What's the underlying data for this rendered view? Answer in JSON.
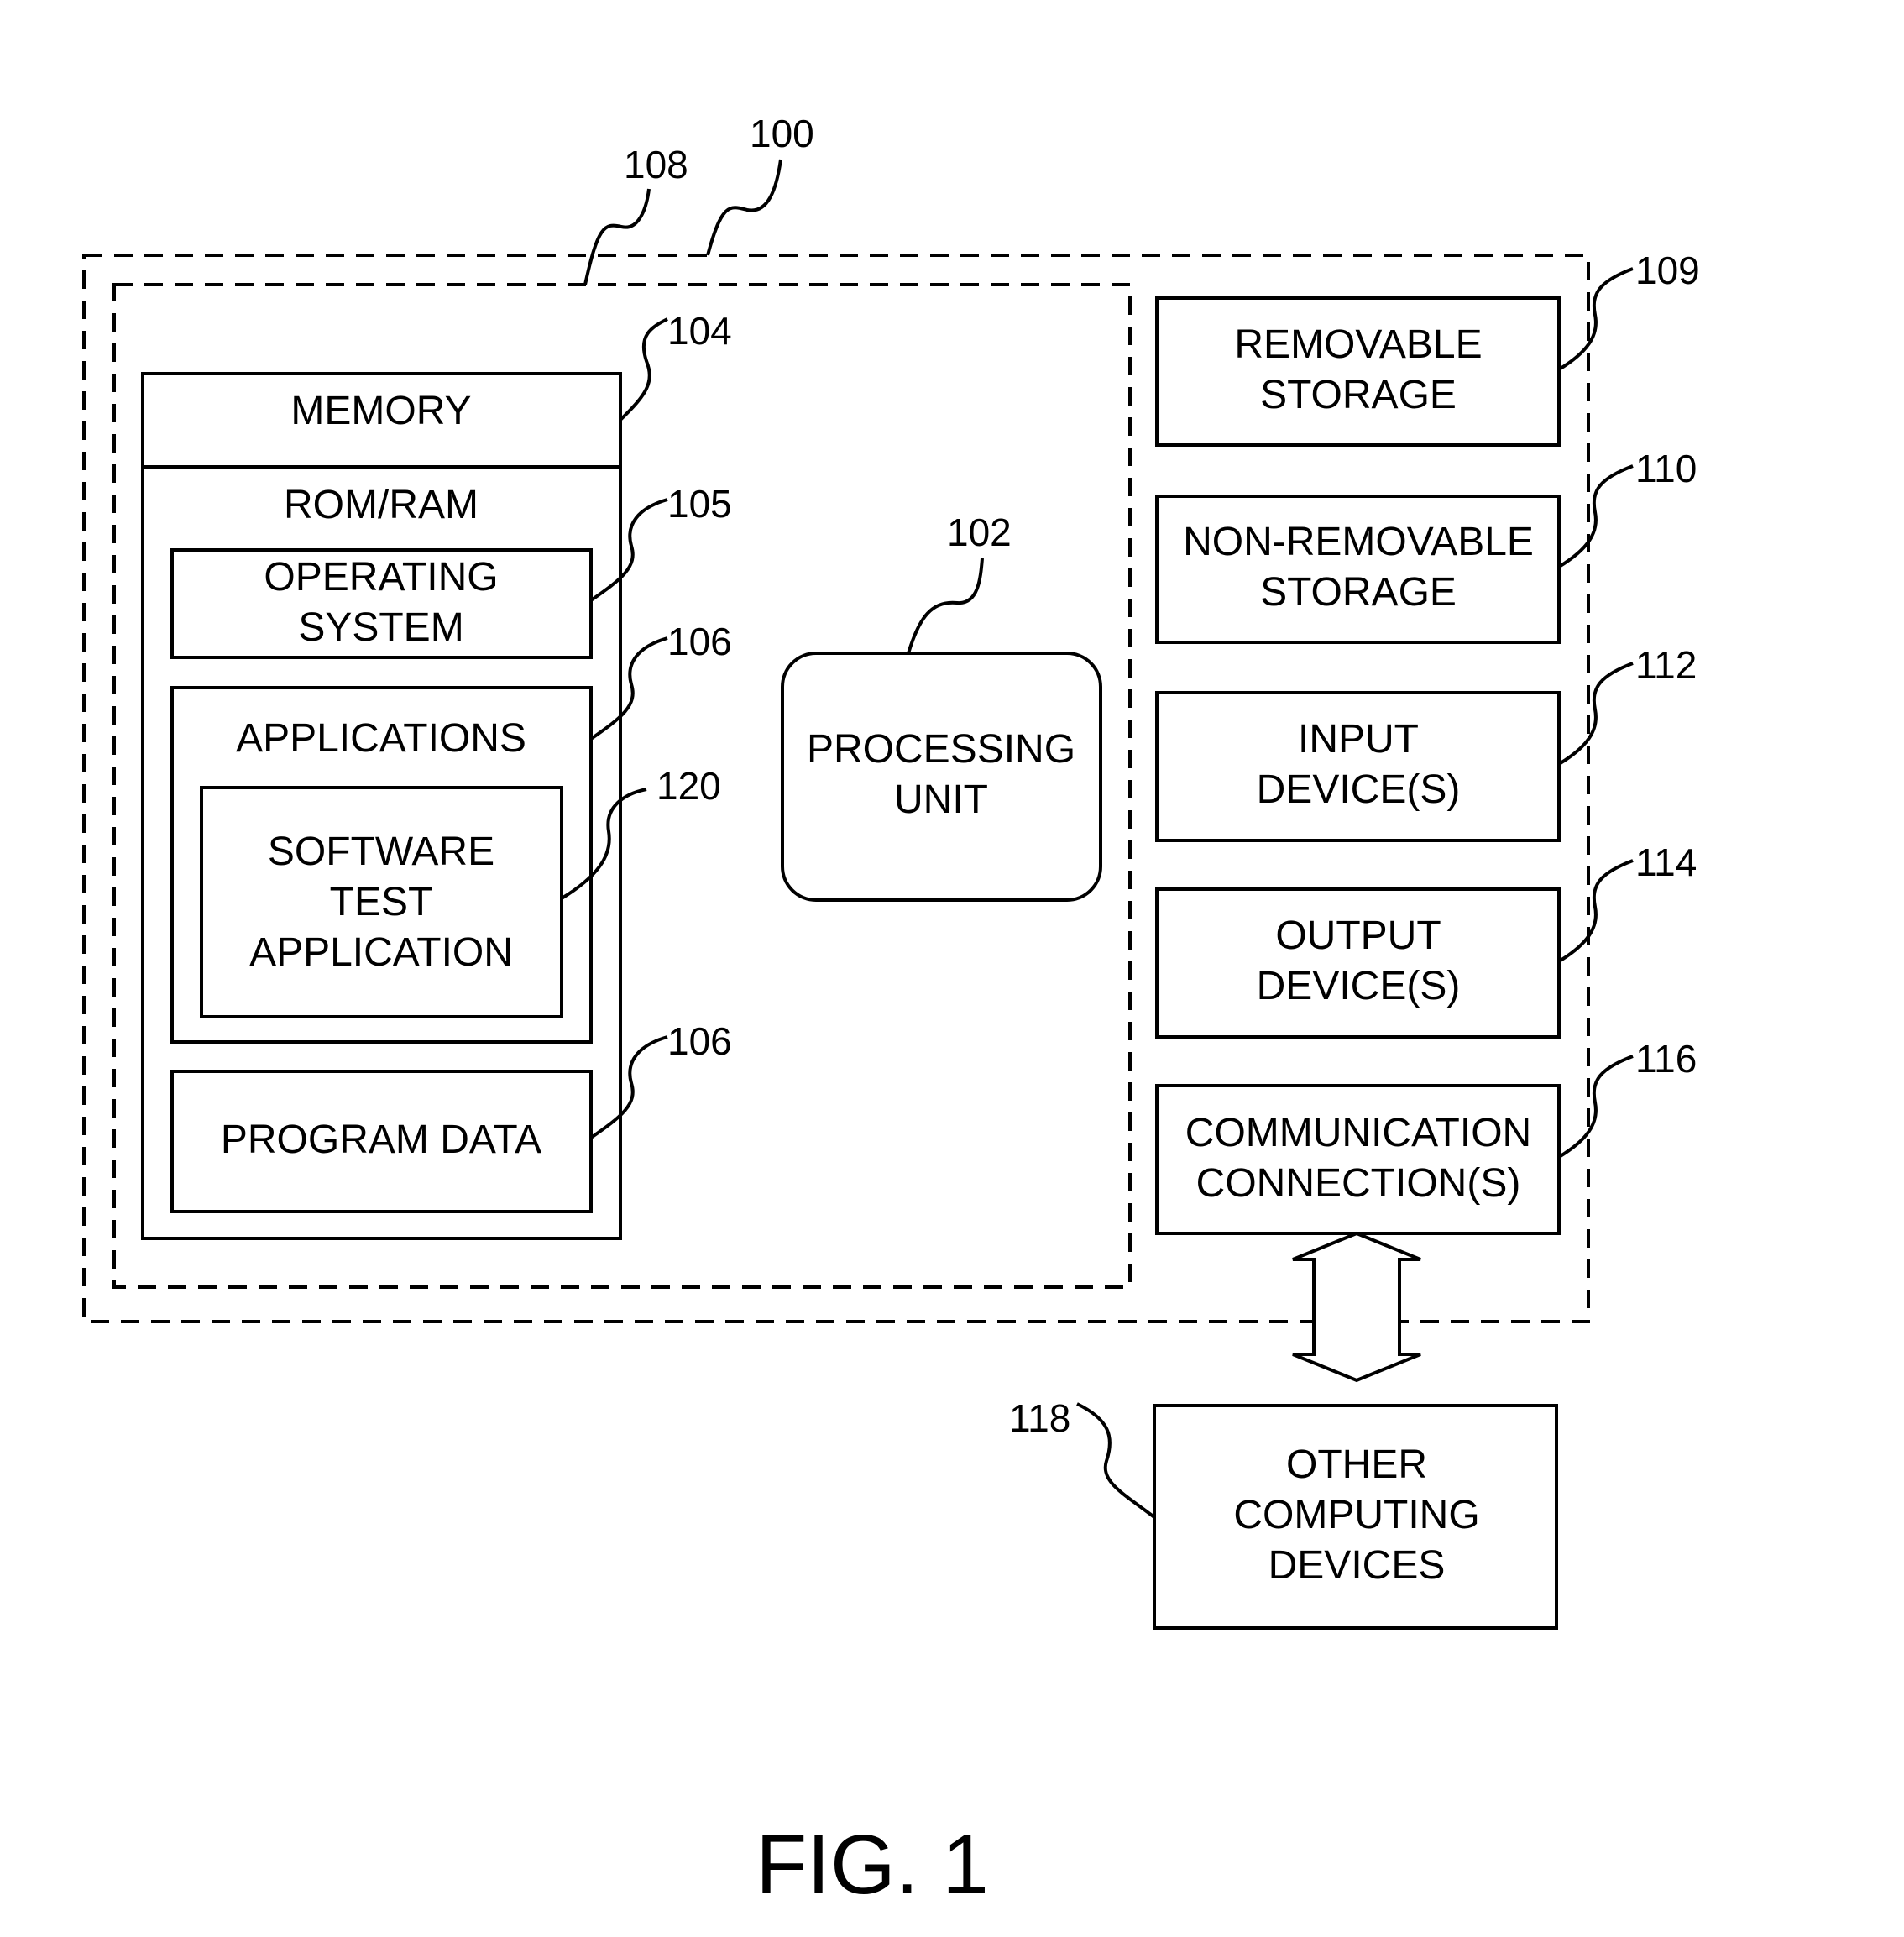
{
  "figure": {
    "caption": "FIG. 1"
  },
  "refs": {
    "device": "100",
    "basic_config": "108",
    "memory": "104",
    "operating_system": "105",
    "applications": "106",
    "software_test_application": "120",
    "program_data": "106",
    "processing_unit": "102",
    "removable_storage": "109",
    "non_removable_storage": "110",
    "input_devices": "112",
    "output_devices": "114",
    "communication_connections": "116",
    "other_computing_devices": "118"
  },
  "blocks": {
    "memory": {
      "title": "MEMORY",
      "subtitle": "ROM/RAM"
    },
    "operating_system": [
      "OPERATING",
      "SYSTEM"
    ],
    "applications": "APPLICATIONS",
    "software_test_application": [
      "SOFTWARE",
      "TEST",
      "APPLICATION"
    ],
    "program_data": "PROGRAM DATA",
    "processing_unit": [
      "PROCESSING",
      "UNIT"
    ],
    "removable_storage": [
      "REMOVABLE",
      "STORAGE"
    ],
    "non_removable_storage": [
      "NON-REMOVABLE",
      "STORAGE"
    ],
    "input_devices": [
      "INPUT",
      "DEVICE(S)"
    ],
    "output_devices": [
      "OUTPUT",
      "DEVICE(S)"
    ],
    "communication_connections": [
      "COMMUNICATION",
      "CONNECTION(S)"
    ],
    "other_computing_devices": [
      "OTHER",
      "COMPUTING",
      "DEVICES"
    ]
  }
}
